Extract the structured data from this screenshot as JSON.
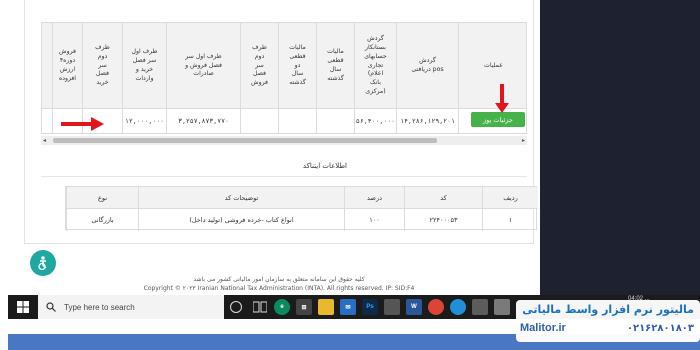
{
  "colors": {
    "accent_green": "#45b24a",
    "arrow_red": "#e2141c",
    "dark_panel": "#1e2230",
    "taskbar": "#1b1b1b",
    "brand_blue": "#2f5cab"
  },
  "top_table": {
    "headers": [
      "عملیات",
      "گردش\nدریافتی pos",
      "گردش\nبستانکار\nحسابهای\nتجاری\n(اعلام\nبانک\nمرکزی)",
      "مالیات\nقطعی\nسال\nگذشته",
      "مالیات\nقطعی\nدو\nسال\nگذشته",
      "طرف\nدوم\nسر\nفصل\nفروش",
      "طرف اول سر\nفصل فروش و\nصادرات",
      "طرف اول\nسر فصل\nخرید و\nواردات",
      "طرف\nدوم\nسر\nفصل\nخرید",
      "فروش\n۴دوره\nارزش\nافزوده"
    ],
    "row": {
      "pos_turnover": "۱۴,۲۸۶,۱۲۹,۲۰۱",
      "creditor_turnover": "۵۶,۴۰۰,۰۰۰",
      "tax_last_year": "",
      "tax_two_years": "",
      "sales_party_two": "",
      "sales_party_one": "۳,۲۵۷,۸۷۳,۷۷۰",
      "purchase_party_one": "۱۲,۰۰۰,۰۰۰",
      "purchase_party_two": "",
      "vat_sales": ""
    },
    "pos_button_label": "جزئیات پوز"
  },
  "info_section": {
    "title": "اطلاعات ایتناکد",
    "headers": [
      "ردیف",
      "کد",
      "درصد",
      "توضیحات کد",
      "نوع"
    ],
    "row": [
      "۱",
      "۲۲۴۰۰۰۵۳",
      "۱۰۰",
      "انواع کتاب -خرده فروشی (تولید داخل)",
      "بازرگانی"
    ]
  },
  "footer": {
    "line1": "کلیه حقوق این سامانه متعلق به سازمان امور مالیاتی کشور می باشد",
    "line2": "Copyright © ۲۰۲۳ Iranian National Tax Administration (INTA). All rights reserved. IP: SID:F4"
  },
  "taskbar": {
    "search_placeholder": "Type here to search",
    "apps": [
      "task-view",
      "edge",
      "store",
      "file-explorer",
      "mail",
      "photoshop",
      "word",
      "chrome",
      "edge-alt",
      "app",
      "app2",
      "app3"
    ],
    "clock": "04:02 ..."
  },
  "watermark": {
    "brand": "مالیتور نرم افزار واسط مالیاتی",
    "domain": "Malitor.ir",
    "phone": "۰۲۱۶۲۸۰۱۸۰۳"
  }
}
